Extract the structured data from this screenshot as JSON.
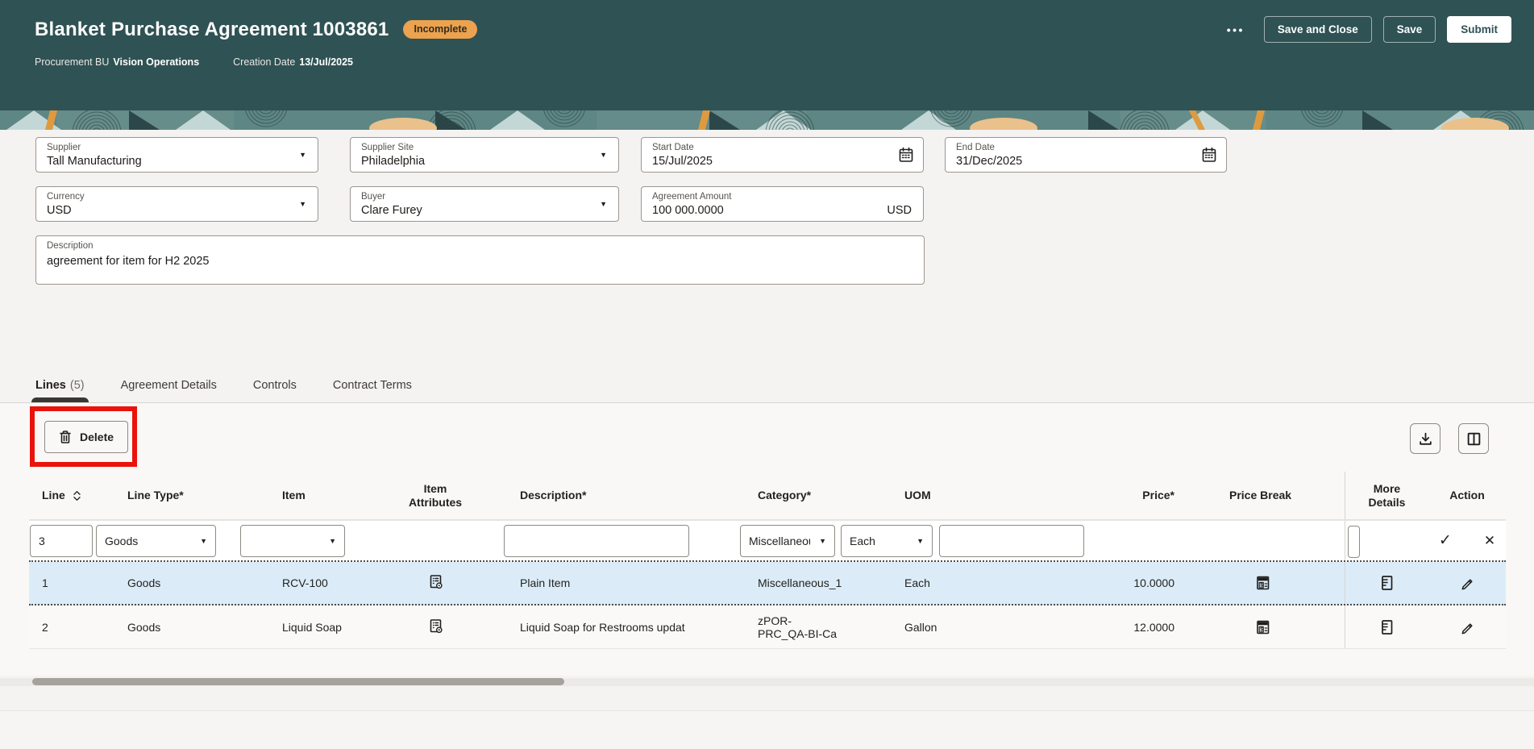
{
  "colors": {
    "header_bg": "#2F5254",
    "badge_bg": "#ECA24E",
    "selected_row_bg": "#DBECF8",
    "annotation_red": "#E9130B"
  },
  "icons": {
    "caret": "▼",
    "check": "✓",
    "close": "✕",
    "ellipsis": "•••"
  },
  "header": {
    "title": "Blanket Purchase Agreement 1003861",
    "status_badge": "Incomplete",
    "buttons": {
      "save_and_close": "Save and Close",
      "save": "Save",
      "submit": "Submit"
    },
    "meta": [
      {
        "label": "Procurement BU",
        "value": "Vision Operations"
      },
      {
        "label": "Creation Date",
        "value": "13/Jul/2025"
      }
    ]
  },
  "form": {
    "supplier": {
      "label": "Supplier",
      "value": "Tall Manufacturing"
    },
    "supplier_site": {
      "label": "Supplier Site",
      "value": "Philadelphia"
    },
    "start_date": {
      "label": "Start Date",
      "value": "15/Jul/2025"
    },
    "end_date": {
      "label": "End Date",
      "value": "31/Dec/2025"
    },
    "currency": {
      "label": "Currency",
      "value": "USD"
    },
    "buyer": {
      "label": "Buyer",
      "value": "Clare Furey"
    },
    "agreement_amount": {
      "label": "Agreement Amount",
      "value": "100 000.0000",
      "suffix": "USD"
    },
    "description": {
      "label": "Description",
      "value": "agreement for item for H2 2025"
    }
  },
  "tabs": [
    {
      "label": "Lines",
      "count": "(5)",
      "active": true
    },
    {
      "label": "Agreement Details"
    },
    {
      "label": "Controls"
    },
    {
      "label": "Contract Terms"
    }
  ],
  "lines_toolbar": {
    "delete": "Delete"
  },
  "table": {
    "columns": [
      "Line",
      "Line Type*",
      "Item",
      "Item Attributes",
      "Description*",
      "Category*",
      "UOM",
      "Price*",
      "Price Break",
      "More Details",
      "Action"
    ],
    "edit_row": {
      "line": "3",
      "line_type": "Goods",
      "item": "",
      "description": "",
      "category": "Miscellaneous",
      "uom": "Each",
      "price": ""
    },
    "rows": [
      {
        "line": "1",
        "line_type": "Goods",
        "item": "RCV-100",
        "description": "Plain Item",
        "category": "Miscellaneous_1",
        "uom": "Each",
        "price": "10.0000",
        "selected": true
      },
      {
        "line": "2",
        "line_type": "Goods",
        "item": "Liquid Soap",
        "description": "Liquid Soap for Restrooms updat",
        "category": "zPOR-PRC_QA-BI-Ca",
        "uom": "Gallon",
        "price": "12.0000",
        "selected": false
      }
    ]
  }
}
